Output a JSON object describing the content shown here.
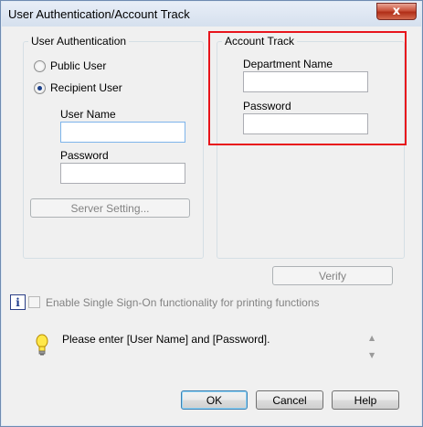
{
  "window": {
    "title": "User Authentication/Account Track",
    "close_glyph": "x"
  },
  "user_auth": {
    "legend": "User Authentication",
    "public_user_label": "Public User",
    "recipient_user_label": "Recipient User",
    "selected": "Recipient User",
    "user_name_label": "User Name",
    "user_name_value": "",
    "password_label": "Password",
    "password_value": "",
    "server_setting_label": "Server Setting..."
  },
  "account_track": {
    "legend": "Account Track",
    "department_name_label": "Department Name",
    "department_name_value": "",
    "password_label": "Password",
    "password_value": ""
  },
  "verify_label": "Verify",
  "sso": {
    "info_glyph": "i",
    "label": "Enable Single Sign-On functionality for printing functions",
    "checked": false
  },
  "message": {
    "icon": "lightbulb-icon",
    "text": "Please enter [User Name] and [Password].",
    "scroll_up_glyph": "▲",
    "scroll_down_glyph": "▼"
  },
  "buttons": {
    "ok": "OK",
    "cancel": "Cancel",
    "help": "Help"
  },
  "colors": {
    "highlight": "#e8141c",
    "dialog_bg": "#f0f0f0"
  }
}
